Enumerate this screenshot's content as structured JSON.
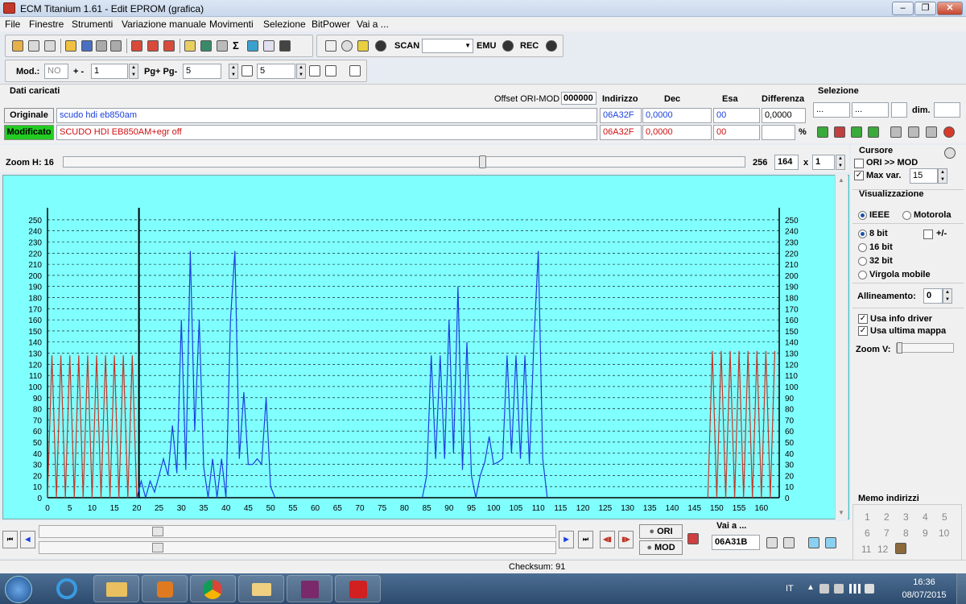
{
  "window": {
    "title": "ECM Titanium 1.61 - Edit EPROM (grafica)",
    "min": "–",
    "max": "❐",
    "close": "✕"
  },
  "menu": [
    "File",
    "Finestre",
    "Strumenti",
    "Variazione manuale",
    "Movimenti",
    "Selezione",
    "BitPower",
    "Vai a ..."
  ],
  "toolbar": {
    "scan_label": "SCAN",
    "emu_label": "EMU",
    "rec_label": "REC",
    "sigma": "Σ",
    "mod_label": "Mod.:",
    "mod_value": "NO",
    "plusminus_label": "+ -",
    "plusminus_value": "1",
    "pg_label": "Pg+ Pg-",
    "pg_value": "5",
    "p_value": "5"
  },
  "data_panel": {
    "title": "Dati caricati",
    "offset_label": "Offset ORI-MOD",
    "offset_value": "000000",
    "col_indirizzo": "Indirizzo",
    "col_dec": "Dec",
    "col_esa": "Esa",
    "col_diff": "Differenza",
    "original_button": "Originale",
    "original_name": "scudo hdi eb850am",
    "original_addr": "06A32F",
    "original_dec": "0,0000",
    "original_esa": "00",
    "original_diff": "0,0000",
    "modified_button": "Modificato",
    "modified_name": "SCUDO HDI EB850AM+egr off",
    "modified_addr": "06A32F",
    "modified_dec": "0,0000",
    "modified_esa": "00",
    "percent": "%",
    "selezione_title": "Selezione",
    "sel_1": "...",
    "sel_2": "...",
    "dim_label": "dim."
  },
  "zoom": {
    "label": "Zoom H:",
    "value": "16",
    "max": "256",
    "count": "164",
    "times": "x",
    "mult": "1"
  },
  "right_panel": {
    "cursore": "Cursore",
    "ori_mod": "ORI >> MOD",
    "max_var": "Max var.",
    "max_var_value": "15",
    "visualizzazione": "Visualizzazione",
    "ieee": "IEEE",
    "motorola": "Motorola",
    "bit8": "8 bit",
    "pm": "+/-",
    "bit16": "16 bit",
    "bit32": "32 bit",
    "virgola": "Virgola mobile",
    "allineamento": "Allineamento:",
    "allineamento_value": "0",
    "usa_info": "Usa info driver",
    "usa_ultima": "Usa ultima mappa",
    "zoom_v": "Zoom V:",
    "memo_title": "Memo indirizzi",
    "memo": [
      "1",
      "2",
      "3",
      "4",
      "5",
      "6",
      "7",
      "8",
      "9",
      "10",
      "11",
      "12"
    ]
  },
  "bottom": {
    "ori_button": "ORI",
    "mod_button": "MOD",
    "vai_label": "Vai a ...",
    "vai_value": "06A31B",
    "checksum": "Checksum: 91"
  },
  "taskbar": {
    "lang": "IT",
    "time": "16:36",
    "date": "08/07/2015"
  },
  "colors": {
    "chart_bg": "#80ffff",
    "ori_line": "#c0392b",
    "mod_line": "#1a3fe0",
    "grid": "#000000",
    "modified_green": "#22cc22"
  },
  "chart_data": {
    "type": "line",
    "x_label_values": [
      0,
      5,
      10,
      15,
      20,
      25,
      30,
      35,
      40,
      45,
      50,
      55,
      60,
      65,
      70,
      75,
      80,
      85,
      90,
      95,
      100,
      105,
      110,
      115,
      120,
      125,
      130,
      135,
      140,
      145,
      150,
      155,
      160
    ],
    "y_ticks": [
      0,
      10,
      20,
      30,
      40,
      50,
      60,
      70,
      80,
      90,
      100,
      110,
      120,
      130,
      140,
      150,
      160,
      170,
      180,
      190,
      200,
      210,
      220,
      230,
      240,
      250
    ],
    "xlim": [
      0,
      164
    ],
    "ylim": [
      0,
      255
    ],
    "grid": "horizontal dashed",
    "series": [
      {
        "color": "#c0392b",
        "x": [
          0,
          1,
          2,
          3,
          4,
          5,
          6,
          7,
          8,
          9,
          10,
          11,
          12,
          13,
          14,
          15,
          16,
          17,
          18,
          19,
          20
        ],
        "values": [
          0,
          128,
          0,
          128,
          0,
          128,
          0,
          128,
          0,
          128,
          0,
          128,
          0,
          128,
          0,
          128,
          0,
          128,
          0,
          128,
          0
        ]
      },
      {
        "color": "#c0392b",
        "x": [
          148,
          149,
          150,
          151,
          152,
          153,
          154,
          155,
          156,
          157,
          158,
          159,
          160,
          161,
          162,
          163
        ],
        "values": [
          0,
          132,
          0,
          132,
          0,
          132,
          0,
          132,
          0,
          132,
          0,
          132,
          0,
          132,
          0,
          132
        ]
      },
      {
        "color": "#1a3fe0",
        "x": [
          20,
          21,
          22,
          23,
          24,
          25,
          26,
          27,
          28,
          29,
          30,
          31,
          32,
          33,
          34,
          35,
          36,
          37,
          38,
          39,
          40,
          41,
          42,
          43,
          44,
          45,
          46,
          47,
          48,
          49,
          50,
          51
        ],
        "values": [
          0,
          15,
          0,
          15,
          5,
          20,
          35,
          20,
          65,
          22,
          160,
          25,
          222,
          60,
          160,
          28,
          0,
          35,
          0,
          35,
          0,
          160,
          222,
          35,
          95,
          30,
          30,
          35,
          30,
          90,
          10,
          0
        ]
      },
      {
        "color": "#1a3fe0",
        "x": [
          84,
          85,
          86,
          87,
          88,
          89,
          90,
          91,
          92,
          93,
          94,
          95,
          96,
          97,
          98,
          99,
          100,
          101,
          102,
          103,
          104,
          105,
          106,
          107,
          108,
          109,
          110,
          111,
          112
        ],
        "values": [
          0,
          20,
          128,
          35,
          128,
          35,
          160,
          40,
          190,
          25,
          140,
          20,
          0,
          20,
          32,
          55,
          30,
          32,
          35,
          128,
          40,
          128,
          35,
          128,
          30,
          140,
          222,
          35,
          0
        ]
      }
    ]
  }
}
